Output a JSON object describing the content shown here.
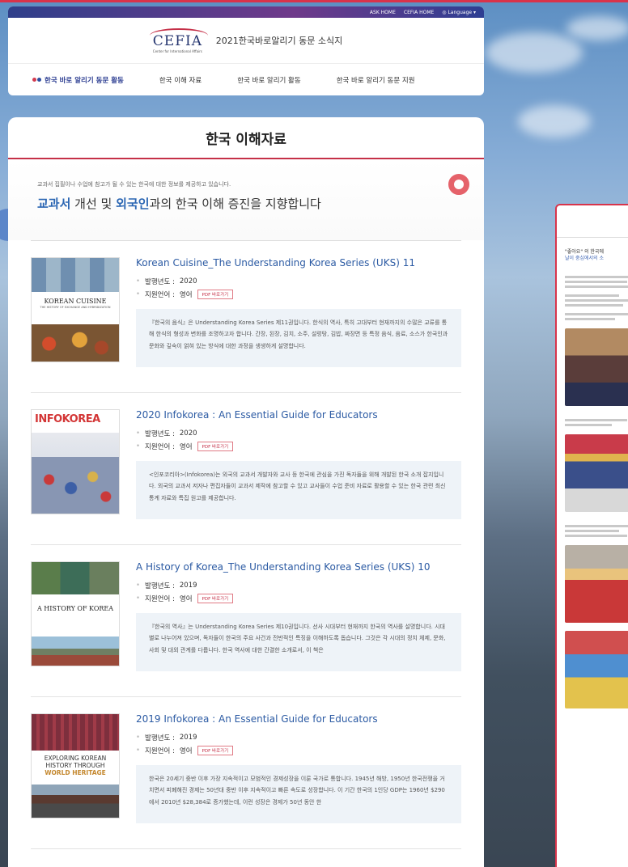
{
  "utility": {
    "links": [
      "ASK HOME",
      "CEFIA HOME"
    ],
    "language": "Language"
  },
  "brand": {
    "logo_text": "CEFIA",
    "logo_sub": "Center for International Affairs",
    "title": "2021한국바로알리기 동문 소식지"
  },
  "nav": {
    "items": [
      "한국 바로 알리기 동문 활동",
      "한국 이해 자료",
      "한국 바로 알리기 활동",
      "한국 바로 알리기 동문 지원"
    ],
    "active_index": 0
  },
  "page": {
    "title": "한국 이해자료",
    "intro_small": "교과서 집필이나 수업에 참고가 될 수 있는 한국에 대한 정보를 제공하고 있습니다.",
    "intro_big_pre": "교과서",
    "intro_big_mid": " 개선 및 ",
    "intro_big_hl": "외국인",
    "intro_big_post": "과의 한국 이해 증진을 지향합니다"
  },
  "labels": {
    "year": "발행년도 : ",
    "lang": "지원언어 : ",
    "pdf": "PDF 바로가기"
  },
  "items": [
    {
      "title": "Korean Cuisine_The Understanding Korea Series (UKS) 11",
      "year": "2020",
      "language": "영어",
      "cover_title": "KOREAN CUISINE",
      "cover_sub": "THE HISTORY OF EXCHANGE AND HYBRIDIZATION",
      "desc": "『한국의 음식』은 Understanding Korea Series 제11권입니다. 한식의 역사, 특히 고대부터 현재까지의 수많은 교류를 통해 한식의 형성과 변화를 조명하고자 합니다. 간장, 된장, 김치, 소주, 설렁탕, 김밥, 짜장면 등 특정 음식, 음료, 소스가 한국인과 문화와 깊숙이 얽혀 있는 방식에 대한 과정을 생생하게 설명합니다."
    },
    {
      "title": "2020 Infokorea : An Essential Guide for Educators",
      "year": "2020",
      "language": "영어",
      "cover_title": "INFOKOREA",
      "cover_sub": "",
      "desc": "<인포코리아>(Infokorea)는 외국의 교과서 개발자와 교사 등 한국에 관심을 가진 독자들을 위해 개발된 한국 소개 잡지입니다. 외국의 교과서 저자나 편집자들이 교과서 제작에 참고할 수 있고 교사들이 수업 준비 자료로 활용할 수 있는 한국 관련 최신 통계 자료와 특집 원고를 제공합니다."
    },
    {
      "title": "A History of Korea_The Understanding Korea Series (UKS) 10",
      "year": "2019",
      "language": "영어",
      "cover_title": "A HISTORY OF KOREA",
      "cover_sub": "",
      "desc": "『한국의 역사』는 Understanding Korea Series 제10권입니다. 선사 시대부터 현재까지 한국의 역사를 설명합니다. 시대별로 나누어져 있으며, 독자들이 한국의 주요 사건과 전반적인 특징을 이해하도록 돕습니다. 그것은 각 시대의 정치 체제, 문화, 사회 및 대외 관계를 다룹니다. 한국 역사에 대한 간결한 소개로서, 이 책은"
    },
    {
      "title": "2019 Infokorea : An Essential Guide for Educators",
      "year": "2019",
      "language": "영어",
      "cover_title": "EXPLORING KOREAN HISTORY THROUGH",
      "cover_sub": "WORLD HERITAGE",
      "desc": "한국은 20세기 중반 이후 가장 지속적이고 모범적인 경제성장을 이룬 국가로 통합니다. 1945년 해방, 1950년 한국전쟁을 거치면서 피폐해진 경제는 50년대 중반 이후 지속적이고 빠른 속도로 성장합니다. 이 기간 한국의 1인당 GDP는 1960년 $290에서 2010년 $28,384로 증가했는데, 이런 성장은 경제가 50년 동안 한"
    }
  ],
  "preview": {
    "lead_pre": "\"좋아요\" 의 한국에",
    "lead_hl": "날이 중심에서의 소"
  }
}
